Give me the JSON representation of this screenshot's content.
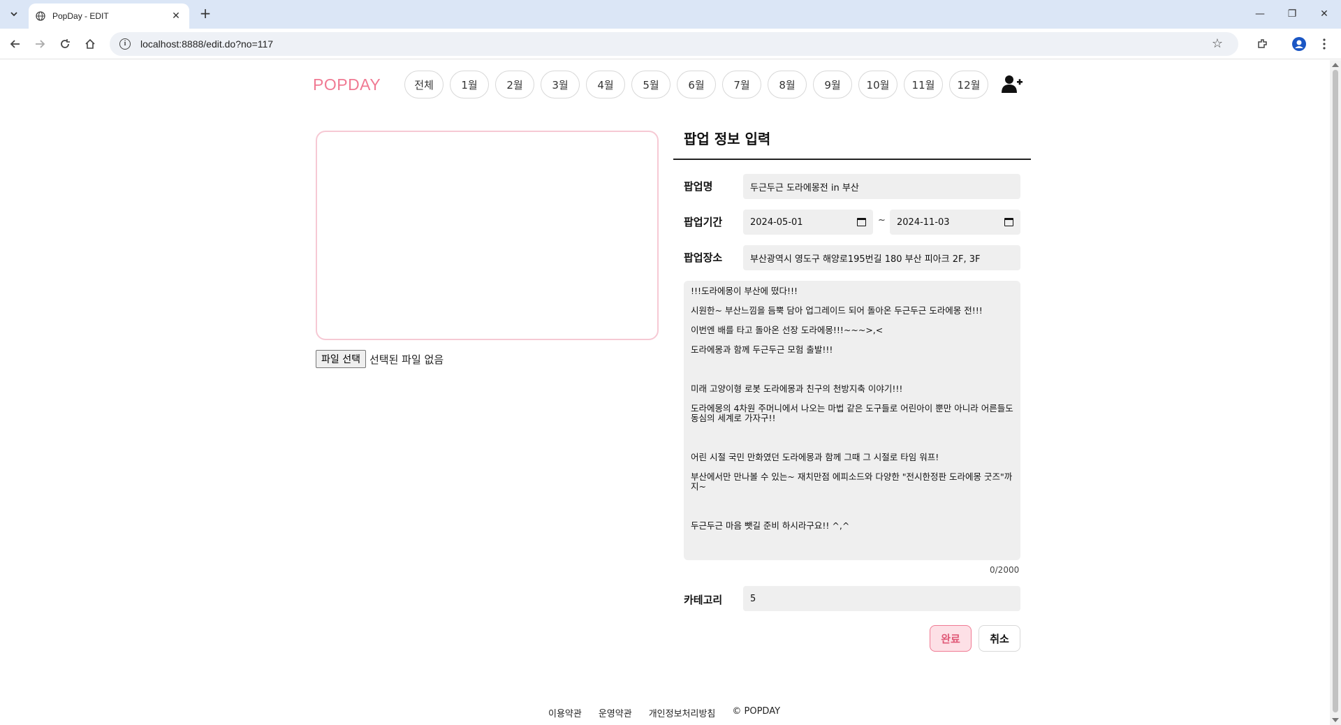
{
  "browser": {
    "tab_title": "PopDay - EDIT",
    "url": "localhost:8888/edit.do?no=117"
  },
  "site": {
    "logo": "POPDAY",
    "months": [
      "전체",
      "1월",
      "2월",
      "3월",
      "4월",
      "5월",
      "6월",
      "7월",
      "8월",
      "9월",
      "10월",
      "11월",
      "12월"
    ]
  },
  "upload": {
    "button_label": "파일 선택",
    "status": "선택된 파일 없음"
  },
  "form": {
    "title": "팝업 정보 입력",
    "name_label": "팝업명",
    "name_value": "두근두근 도라에몽전 in 부산",
    "period_label": "팝업기간",
    "start_date": "2024-05-01",
    "separator": "~",
    "end_date": "2024-11-03",
    "place_label": "팝업장소",
    "place_value": "부산광역시 영도구 해양로195번길 180 부산 피아크 2F, 3F",
    "description_lines": [
      "!!!도라에몽이 부산에 떴다!!!",
      "시원한~ 부산느낌을 듬뿍 담아 업그레이드 되어 돌아온 두근두근 도라에몽 전!!!",
      "이번엔 배를 타고 돌아온 선장 도라에몽!!!~~~>,<",
      "도라에몽과 함께 두근두근 모험 출발!!!",
      "",
      "미래 고양이형 로봇 도라에몽과 친구의 천방지축 이야기!!!",
      "도라에몽의 4차원 주머니에서 나오는 마법 같은 도구들로 어린아이 뿐만 아니라 어른들도 동심의 세계로 가자구!!",
      "",
      "어린 시절 국민 만화였던 도라에몽과 함께 그때 그 시절로 타임 워프!",
      "부산에서만 만나볼 수 있는~ 재치만점 에피소드와 다양한 \"전시한정판 도라에몽 굿즈\"까지~",
      "",
      "두근두근 마음 뺏길 준비 하시라구요!! ^,^"
    ],
    "char_counter": "0/2000",
    "category_label": "카테고리",
    "category_value": "5",
    "done_label": "완료",
    "cancel_label": "취소"
  },
  "footer": {
    "links": [
      "이용약관",
      "운영약관",
      "개인정보처리방침",
      "© POPDAY"
    ]
  },
  "colors": {
    "brand_pink": "#f07a93",
    "done_bg": "#fde0e6",
    "field_bg": "#efefef"
  }
}
